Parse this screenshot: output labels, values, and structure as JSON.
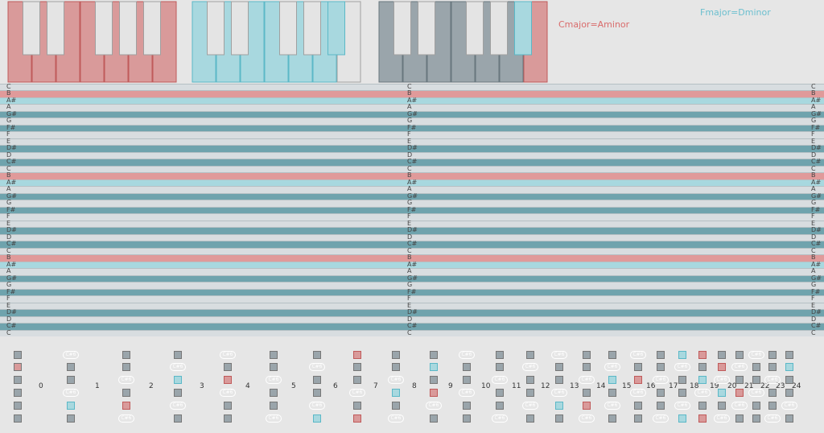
{
  "legend": {
    "cmajor": {
      "label": "Cmajor=Aminor",
      "color": "#d96b6b"
    },
    "fmajor": {
      "label": "Fmajor=Dminor",
      "color": "#6bbfcf"
    }
  },
  "colors": {
    "red": "#d99a9a",
    "red_border": "#c05a5a",
    "cyan": "#a8d8df",
    "cyan_border": "#5bb8c7",
    "gray": "#9aa5ab",
    "gray_border": "#68767e",
    "white_key": "#e4e4e4",
    "white_key_border": "#a0a0a0",
    "lane_teal": "#6fa3ad",
    "lane_light": "#d8dde0",
    "lane_red": "#e09a9a",
    "lane_cyan": "#a8d8df"
  },
  "keyboards": [
    {
      "name": "cmajor-keyboard",
      "fill": "red"
    },
    {
      "name": "fmajor-keyboard",
      "fill": "cyan"
    },
    {
      "name": "mixed-keyboard",
      "fill": "gray"
    }
  ],
  "roll": {
    "notes": [
      "C",
      "B",
      "A#",
      "A",
      "G#",
      "G",
      "F#",
      "F",
      "E",
      "D#",
      "D",
      "C#",
      "C",
      "B",
      "A#",
      "A",
      "G#",
      "G",
      "F#",
      "F",
      "E",
      "D#",
      "D",
      "C#",
      "C",
      "B",
      "A#",
      "A",
      "G#",
      "G",
      "F#",
      "F",
      "E",
      "D#",
      "D",
      "C#",
      "C"
    ]
  },
  "fretboard": {
    "fret_numbers": [
      "0",
      "1",
      "2",
      "3",
      "4",
      "5",
      "6",
      "7",
      "8",
      "9",
      "10",
      "11",
      "12",
      "13",
      "14",
      "15",
      "16",
      "17",
      "18",
      "19",
      "20",
      "21",
      "22",
      "23",
      "24"
    ],
    "pill_text": "C#6"
  }
}
